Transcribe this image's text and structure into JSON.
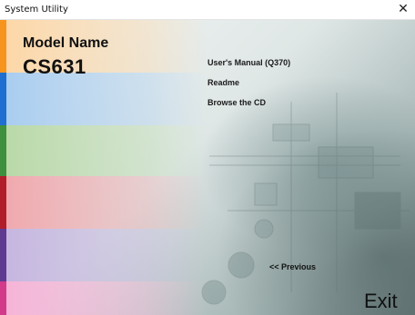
{
  "window": {
    "title": "System Utility",
    "close_symbol": "✕"
  },
  "brand": {
    "model_label": "Model Name",
    "model_value": "CS631"
  },
  "menu": {
    "items": [
      {
        "label": "User's Manual (Q370)"
      },
      {
        "label": "Readme"
      },
      {
        "label": "Browse the CD"
      }
    ]
  },
  "nav": {
    "previous_label": "<< Previous",
    "exit_label": "Exit"
  },
  "colors": {
    "strips": [
      "#f7941d",
      "#1e6fd0",
      "#3e8f3e",
      "#b01e2a",
      "#5e3a91",
      "#d23a8a"
    ],
    "bands": [
      "#fcd7a8",
      "#a9cdf0",
      "#b9d9a8",
      "#f0a9ae",
      "#c6b6e0",
      "#f6b4d7"
    ]
  }
}
